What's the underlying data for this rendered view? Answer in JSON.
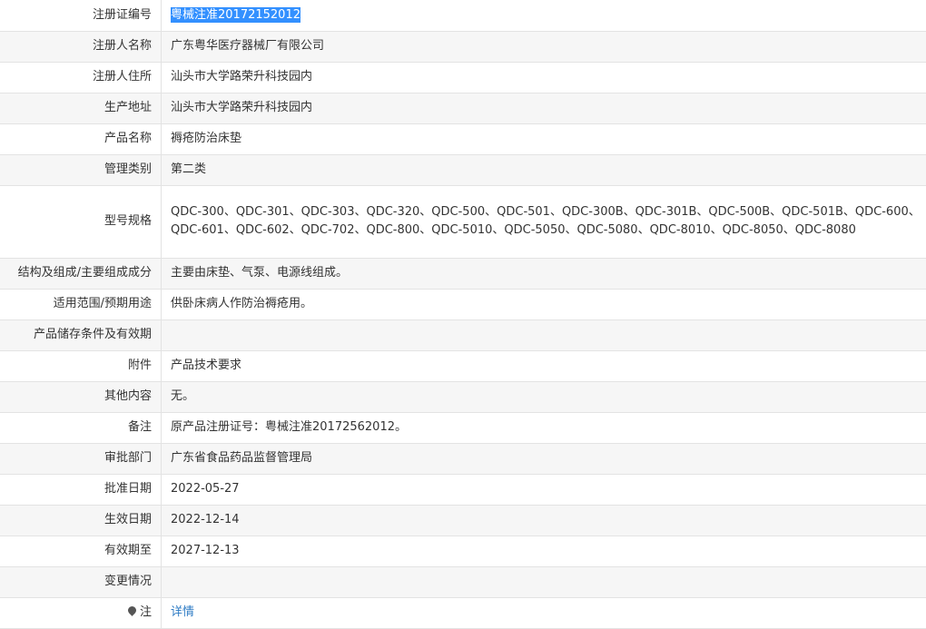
{
  "rows": [
    {
      "label": "注册证编号",
      "value": "粤械注准20172152012"
    },
    {
      "label": "注册人名称",
      "value": "广东粤华医疗器械厂有限公司"
    },
    {
      "label": "注册人住所",
      "value": "汕头市大学路荣升科技园内"
    },
    {
      "label": "生产地址",
      "value": "汕头市大学路荣升科技园内"
    },
    {
      "label": "产品名称",
      "value": "褥疮防治床垫"
    },
    {
      "label": "管理类别",
      "value": "第二类"
    },
    {
      "label": "型号规格",
      "value": "QDC-300、QDC-301、QDC-303、QDC-320、QDC-500、QDC-501、QDC-300B、QDC-301B、QDC-500B、QDC-501B、QDC-600、QDC-601、QDC-602、QDC-702、QDC-800、QDC-5010、QDC-5050、QDC-5080、QDC-8010、QDC-8050、QDC-8080"
    },
    {
      "label": "结构及组成/主要组成成分",
      "value": "主要由床垫、气泵、电源线组成。"
    },
    {
      "label": "适用范围/预期用途",
      "value": "供卧床病人作防治褥疮用。"
    },
    {
      "label": "产品储存条件及有效期",
      "value": ""
    },
    {
      "label": "附件",
      "value": "产品技术要求"
    },
    {
      "label": "其他内容",
      "value": "无。"
    },
    {
      "label": "备注",
      "value": "原产品注册证号：粤械注准20172562012。"
    },
    {
      "label": "审批部门",
      "value": "广东省食品药品监督管理局"
    },
    {
      "label": "批准日期",
      "value": "2022-05-27"
    },
    {
      "label": "生效日期",
      "value": "2022-12-14"
    },
    {
      "label": "有效期至",
      "value": "2027-12-13"
    },
    {
      "label": "变更情况",
      "value": ""
    },
    {
      "label": "注",
      "value": "详情",
      "icon": "pin-icon"
    }
  ]
}
